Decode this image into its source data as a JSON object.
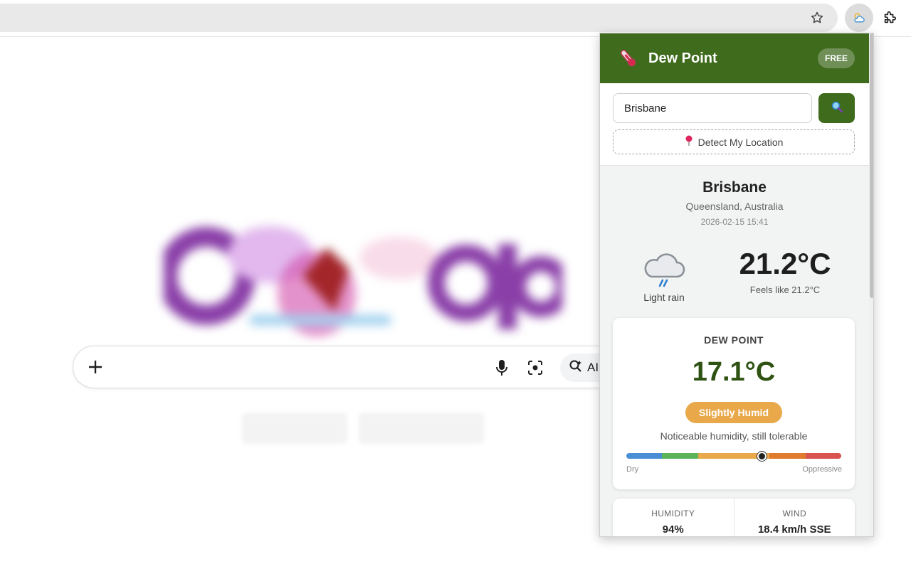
{
  "browser": {
    "toolbar_icons": [
      "star-icon",
      "weather-extension-icon",
      "puzzle-icon"
    ]
  },
  "google": {
    "ai_mode_label": "AI",
    "icons": [
      "plus-icon",
      "mic-icon",
      "lens-icon",
      "ai-search-icon"
    ]
  },
  "popup": {
    "title": "Dew Point",
    "badge": "FREE",
    "search": {
      "value": "Brisbane"
    },
    "detect_label": "Detect My Location",
    "location": {
      "city": "Brisbane",
      "region": "Queensland, Australia",
      "datetime": "2026-02-15 15:41"
    },
    "current": {
      "condition": "Light rain",
      "temperature": "21.2°C",
      "feels_like": "Feels like 21.2°C"
    },
    "dew": {
      "label": "DEW POINT",
      "value": "17.1°C",
      "level": "Slightly Humid",
      "description": "Noticeable humidity, still tolerable",
      "scale_low": "Dry",
      "scale_high": "Oppressive",
      "scale_position": 0.63,
      "scale_colors": [
        "#4a8fd6",
        "#5cb35a",
        "#e9a94b",
        "#e9a94b",
        "#e07a2e",
        "#d9534f"
      ]
    },
    "stats": [
      {
        "label": "HUMIDITY",
        "value": "94%"
      },
      {
        "label": "WIND",
        "value": "18.4 km/h SSE"
      }
    ],
    "colors": {
      "header": "#3f6b1c",
      "badge": "#e9a94b",
      "dew_value": "#2e5212"
    }
  }
}
